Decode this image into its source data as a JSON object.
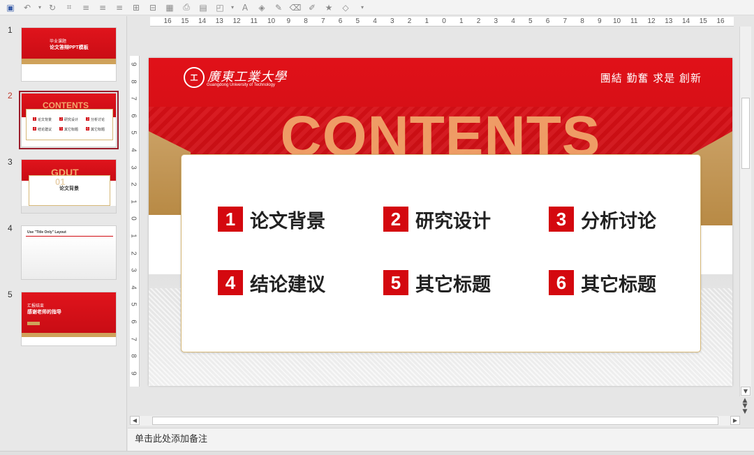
{
  "toolbar": {
    "icons": [
      "save-icon",
      "undo-icon",
      "chevron-down-icon",
      "redo-icon",
      "format-painter-icon",
      "align-icon",
      "align-icon",
      "align-icon",
      "distribute-icon",
      "distribute-icon",
      "table-icon",
      "print-icon",
      "picture-icon",
      "shapes-icon",
      "chevron-down-icon",
      "font-color-icon",
      "fill-icon",
      "pen-icon",
      "eraser-icon",
      "star-icon",
      "effects-icon",
      "more-icon"
    ],
    "font_glyph": "A"
  },
  "thumbnails": [
    {
      "number": "1",
      "line1": "毕业课题",
      "line2": "论文答辩PPT模板"
    },
    {
      "number": "2",
      "title": "CONTENTS",
      "items": [
        "论文背景",
        "研究设计",
        "分析讨论",
        "结论建议",
        "其它标题",
        "其它标题"
      ]
    },
    {
      "number": "3",
      "big": "GDUT",
      "num": "01",
      "heading": "论文背景"
    },
    {
      "number": "4",
      "label": "Use \"Title Only\" Layout"
    },
    {
      "number": "5",
      "line1": "汇报结束",
      "line2": "感谢老师的指导"
    }
  ],
  "ruler": {
    "horizontal": [
      "16",
      "15",
      "14",
      "13",
      "12",
      "11",
      "10",
      "9",
      "8",
      "7",
      "6",
      "5",
      "4",
      "3",
      "2",
      "1",
      "0",
      "1",
      "2",
      "3",
      "4",
      "5",
      "6",
      "7",
      "8",
      "9",
      "10",
      "11",
      "12",
      "13",
      "14",
      "15",
      "16"
    ],
    "vertical": [
      "9",
      "8",
      "7",
      "6",
      "5",
      "4",
      "3",
      "2",
      "1",
      "0",
      "1",
      "2",
      "3",
      "4",
      "5",
      "6",
      "7",
      "8",
      "9"
    ]
  },
  "slide": {
    "logo_text": "工",
    "university_name": "廣東工業大學",
    "university_en": "Guangdong University of Technology",
    "motto": "團結 勤奮 求是 創新",
    "contents_word": "CONTENTS",
    "items": [
      {
        "num": "1",
        "label": "论文背景"
      },
      {
        "num": "2",
        "label": "研究设计"
      },
      {
        "num": "3",
        "label": "分析讨论"
      },
      {
        "num": "4",
        "label": "结论建议"
      },
      {
        "num": "5",
        "label": "其它标题"
      },
      {
        "num": "6",
        "label": "其它标题"
      }
    ]
  },
  "notes": {
    "placeholder": "单击此处添加备注"
  },
  "colors": {
    "brand_red": "#d4080f",
    "gold": "#caa064",
    "selection": "#9a1b2a"
  }
}
